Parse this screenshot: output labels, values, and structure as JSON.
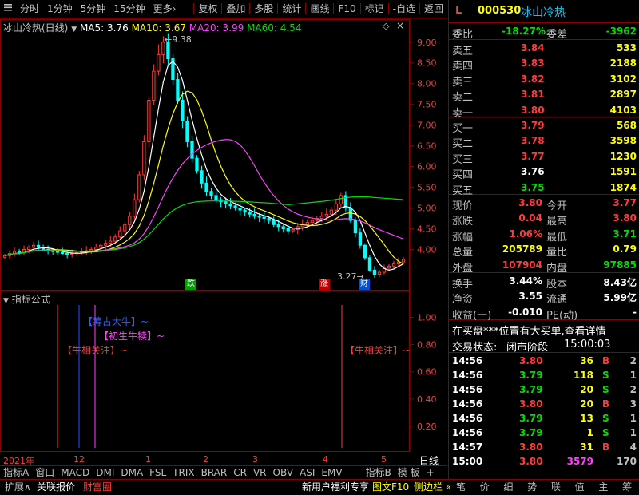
{
  "toolbar": {
    "left": [
      "分时",
      "1分钟",
      "5分钟",
      "15分钟",
      "更多"
    ],
    "more_arrow": "›",
    "right": [
      "复权",
      "叠加",
      "多股",
      "统计",
      "画线",
      "F10",
      "标记",
      "-自选",
      "返回"
    ]
  },
  "chart": {
    "title": "冰山冷热(日线)",
    "ma5": "MA5: 3.76",
    "ma10": "MA10: 3.67",
    "ma20": "MA20: 3.99",
    "ma60": "MA60: 4.54",
    "high_label": "9.38",
    "low_label": "3.27",
    "y_ticks": [
      "9.00",
      "8.50",
      "8.00",
      "7.50",
      "7.00",
      "6.50",
      "6.00",
      "5.50",
      "5.00",
      "4.50",
      "4.00"
    ],
    "marker_1": "跌",
    "marker_2": "涨",
    "marker_3": "财",
    "colors": {
      "up": "#ff3c3c",
      "down": "#00ffff",
      "ma5": "#ffffff",
      "ma10": "#ffff00",
      "ma20": "#ff40ff",
      "ma60": "#00e000"
    }
  },
  "chart_data": {
    "type": "line",
    "title": "冰山冷热(日线)",
    "series": [
      {
        "name": "MA5",
        "last": 3.76
      },
      {
        "name": "MA10",
        "last": 3.67
      },
      {
        "name": "MA20",
        "last": 3.99
      },
      {
        "name": "MA60",
        "last": 4.54
      }
    ],
    "close": [
      3.85,
      3.9,
      3.95,
      3.92,
      4.0,
      4.05,
      4.1,
      4.05,
      4.0,
      3.98,
      3.95,
      3.93,
      3.9,
      3.88,
      3.9,
      3.92,
      3.95,
      3.97,
      4.0,
      4.05,
      4.1,
      4.15,
      4.2,
      4.3,
      4.45,
      4.6,
      4.8,
      5.2,
      5.8,
      6.6,
      7.6,
      8.3,
      8.7,
      9.0,
      8.6,
      8.1,
      7.6,
      7.1,
      6.6,
      6.2,
      5.9,
      5.6,
      5.4,
      5.3,
      5.2,
      5.15,
      5.1,
      5.05,
      5.0,
      4.95,
      4.9,
      4.85,
      4.8,
      4.78,
      4.75,
      4.7,
      4.6,
      4.55,
      4.5,
      4.45,
      4.48,
      4.55,
      4.6,
      4.65,
      4.7,
      4.75,
      4.8,
      4.85,
      4.95,
      5.1,
      5.3,
      5.0,
      4.7,
      4.4,
      4.1,
      3.8,
      3.5,
      3.4,
      3.45,
      3.55,
      3.6,
      3.65,
      3.7,
      3.76
    ],
    "ylim": [
      3.2,
      9.4
    ],
    "y_ticks": [
      9.0,
      8.5,
      8.0,
      7.5,
      7.0,
      6.5,
      6.0,
      5.5,
      5.0,
      4.5,
      4.0
    ],
    "high": 9.38,
    "low": 3.27
  },
  "indicator": {
    "title": "指标公式",
    "y_ticks": [
      "1.00",
      "0.80",
      "0.60",
      "0.40",
      "0.20"
    ],
    "label_1": "【筹占大牛】~",
    "label_2": "【初生牛犊】~",
    "label_3": "【牛相关注】~",
    "label_4": "【牛相关注】~"
  },
  "timeline": {
    "labels": [
      "2021年",
      "12",
      "1",
      "2",
      "3",
      "4",
      "5"
    ],
    "period": "日线"
  },
  "tabs": [
    "指标A",
    "窗口",
    "MACD",
    "DMI",
    "DMA",
    "FSL",
    "TRIX",
    "BRAR",
    "CR",
    "VR",
    "OBV",
    "ASI",
    "EMV"
  ],
  "tabs_right": [
    "指标B",
    "模 板",
    "+",
    "-"
  ],
  "bottom_left": [
    "扩展∧",
    "关联报价",
    "财富圈"
  ],
  "bottom_mid": [
    "新用户福利专享",
    "图文F10",
    "侧边栏 «"
  ],
  "bottom_right": [
    "笔",
    "价",
    "细",
    "势",
    "联",
    "值",
    "主",
    "筹"
  ],
  "quote": {
    "flag": "L",
    "code": "000530",
    "name": "冰山冷热",
    "weibi_label": "委比",
    "weibi": "-18.27%",
    "weicha_label": "委差",
    "weicha": "-3962",
    "sell": [
      {
        "label": "卖五",
        "price": "3.84",
        "vol": "533"
      },
      {
        "label": "卖四",
        "price": "3.83",
        "vol": "2188"
      },
      {
        "label": "卖三",
        "price": "3.82",
        "vol": "3102"
      },
      {
        "label": "卖二",
        "price": "3.81",
        "vol": "2897"
      },
      {
        "label": "卖一",
        "price": "3.80",
        "vol": "4103"
      }
    ],
    "buy": [
      {
        "label": "买一",
        "price": "3.79",
        "vol": "568"
      },
      {
        "label": "买二",
        "price": "3.78",
        "vol": "3598"
      },
      {
        "label": "买三",
        "price": "3.77",
        "vol": "1230"
      },
      {
        "label": "买四",
        "price": "3.76",
        "vol": "1591"
      },
      {
        "label": "买五",
        "price": "3.75",
        "vol": "1874"
      }
    ],
    "stats": [
      {
        "l1": "现价",
        "v1": "3.80",
        "l2": "今开",
        "v2": "3.77"
      },
      {
        "l1": "涨跌",
        "v1": "0.04",
        "l2": "最高",
        "v2": "3.80"
      },
      {
        "l1": "涨幅",
        "v1": "1.06%",
        "l2": "最低",
        "v2": "3.71"
      },
      {
        "l1": "总量",
        "v1": "205789",
        "l2": "量比",
        "v2": "0.79"
      },
      {
        "l1": "外盘",
        "v1": "107904",
        "l2": "内盘",
        "v2": "97885"
      }
    ],
    "stats2": [
      {
        "l1": "换手",
        "v1": "3.44%",
        "l2": "股本",
        "v2": "8.43亿"
      },
      {
        "l1": "净资",
        "v1": "3.55",
        "l2": "流通",
        "v2": "5.99亿"
      },
      {
        "l1": "收益(一)",
        "v1": "-0.010",
        "l2": "PE(动)",
        "v2": "-"
      }
    ],
    "notice": "在买盘***位置有大买单,查看详情",
    "status_label": "交易状态:",
    "status": "闭市阶段",
    "status_time": "15:00:03",
    "ticks": [
      {
        "t": "14:56",
        "p": "3.80",
        "v": "36",
        "d": "B",
        "n": "2"
      },
      {
        "t": "14:56",
        "p": "3.79",
        "v": "118",
        "d": "S",
        "n": "1"
      },
      {
        "t": "14:56",
        "p": "3.79",
        "v": "20",
        "d": "S",
        "n": "2"
      },
      {
        "t": "14:56",
        "p": "3.80",
        "v": "20",
        "d": "B",
        "n": "3"
      },
      {
        "t": "14:56",
        "p": "3.79",
        "v": "13",
        "d": "S",
        "n": "1"
      },
      {
        "t": "14:56",
        "p": "3.79",
        "v": "1",
        "d": "S",
        "n": "1"
      },
      {
        "t": "14:57",
        "p": "3.80",
        "v": "31",
        "d": "B",
        "n": "4"
      },
      {
        "t": "15:00",
        "p": "3.80",
        "v": "3579",
        "d": "",
        "n": "170"
      }
    ]
  }
}
